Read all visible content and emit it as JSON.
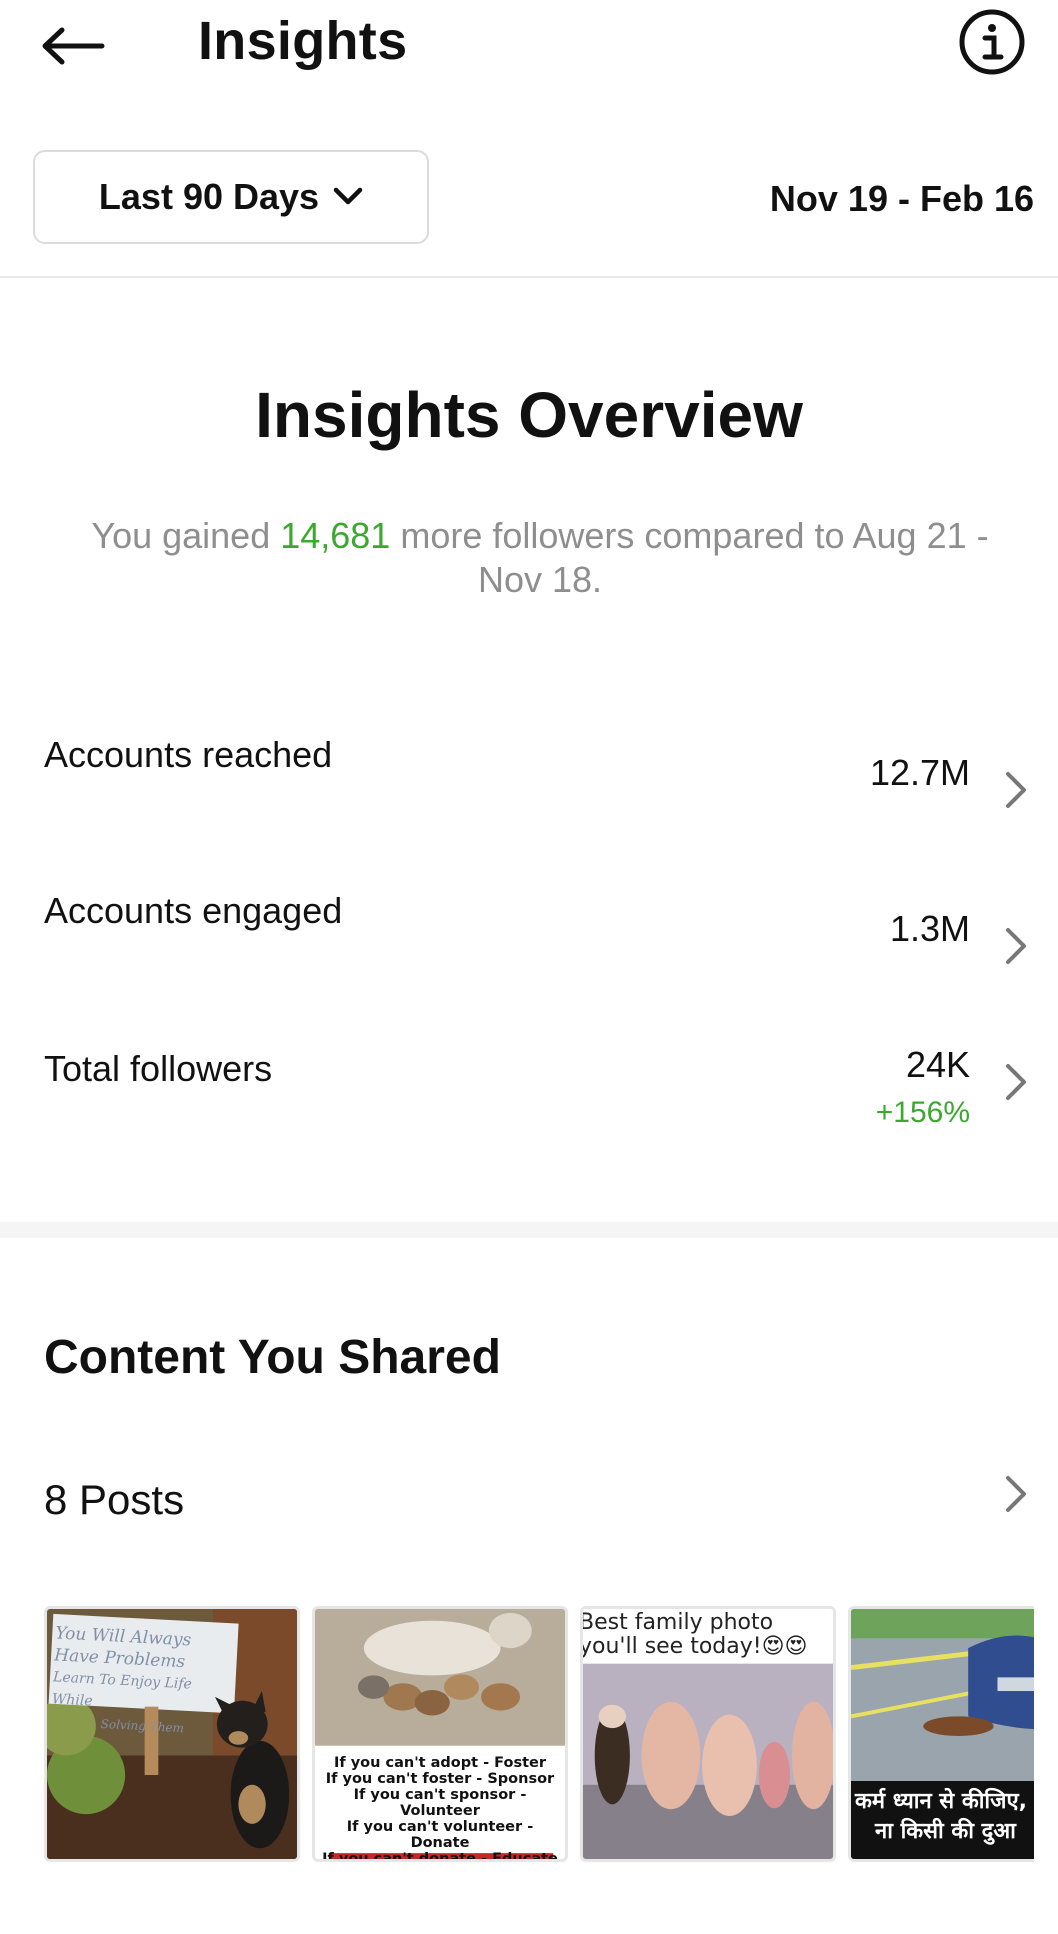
{
  "header": {
    "title": "Insights",
    "back_icon": "arrow-left-icon",
    "info_icon": "info-circle-icon"
  },
  "date_filter": {
    "selected": "Last 90 Days",
    "range": "Nov 19 - Feb 16"
  },
  "overview": {
    "title": "Insights Overview",
    "summary_prefix": "You gained ",
    "summary_value": "14,681",
    "summary_suffix": " more followers compared to Aug 21 - Nov 18.",
    "metrics": [
      {
        "label": "Accounts reached",
        "value": "12.7M"
      },
      {
        "label": "Accounts engaged",
        "value": "1.3M"
      },
      {
        "label": "Total followers",
        "value": "24K",
        "change": "+156%"
      }
    ]
  },
  "content": {
    "title": "Content You Shared",
    "posts_label": "8 Posts",
    "thumbnails": [
      {
        "sign_line1": "You Will Always Have Problems",
        "sign_line2": "Learn To Enjoy Life While",
        "sign_line3": "Solving Them"
      },
      {
        "caption_lines": [
          "If you can't adopt - Foster",
          "If you can't foster - Sponsor",
          "If you can't sponsor - Volunteer",
          "If you can't volunteer - Donate",
          "If you can't donate - Educate"
        ]
      },
      {
        "caption_line1": "Best family photo",
        "caption_line2": "you'll see today!😍😍"
      },
      {
        "caption_line1": "कर्म ध्यान से कीजिए,",
        "caption_line2": "ना किसी की दुआ"
      }
    ]
  },
  "colors": {
    "accent_green": "#3ca82f",
    "muted_text": "#8e8e8e"
  }
}
